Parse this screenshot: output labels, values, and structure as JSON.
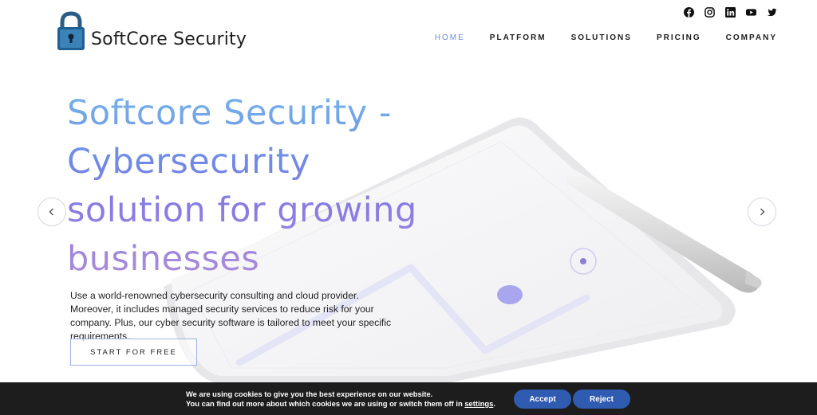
{
  "brand": {
    "name": "SoftCore Security"
  },
  "social": [
    {
      "icon": "facebook-icon"
    },
    {
      "icon": "instagram-icon"
    },
    {
      "icon": "linkedin-icon"
    },
    {
      "icon": "youtube-icon"
    },
    {
      "icon": "twitter-icon"
    }
  ],
  "nav": {
    "items": [
      {
        "label": "HOME",
        "active": true
      },
      {
        "label": "PLATFORM",
        "active": false
      },
      {
        "label": "SOLUTIONS",
        "active": false
      },
      {
        "label": "PRICING",
        "active": false
      },
      {
        "label": "COMPANY",
        "active": false
      }
    ]
  },
  "hero": {
    "title_lines": [
      "Softcore Security -",
      "Cybersecurity",
      "solution for growing",
      "businesses"
    ],
    "description": "Use a world-renowned cybersecurity consulting and cloud provider. Moreover, it includes managed security services to reduce risk for your company. Plus, our cyber security software is tailored to meet your specific requirements.",
    "cta_label": "START FOR FREE",
    "prev_icon": "chevron-left-icon",
    "next_icon": "chevron-right-icon"
  },
  "cookie": {
    "line1": "We are using cookies to give you the best experience on our website.",
    "line2_prefix": "You can find out more about which cookies we are using or switch them off in ",
    "line2_link": "settings",
    "line2_suffix": ".",
    "accept_label": "Accept",
    "reject_label": "Reject"
  },
  "colors": {
    "accent": "#6b8ee0",
    "cookie_bar": "#1d1d1d",
    "cookie_button": "#2f5bb0",
    "title_gradient_top": "#74b7ea",
    "title_gradient_bottom": "#b08ed8"
  }
}
